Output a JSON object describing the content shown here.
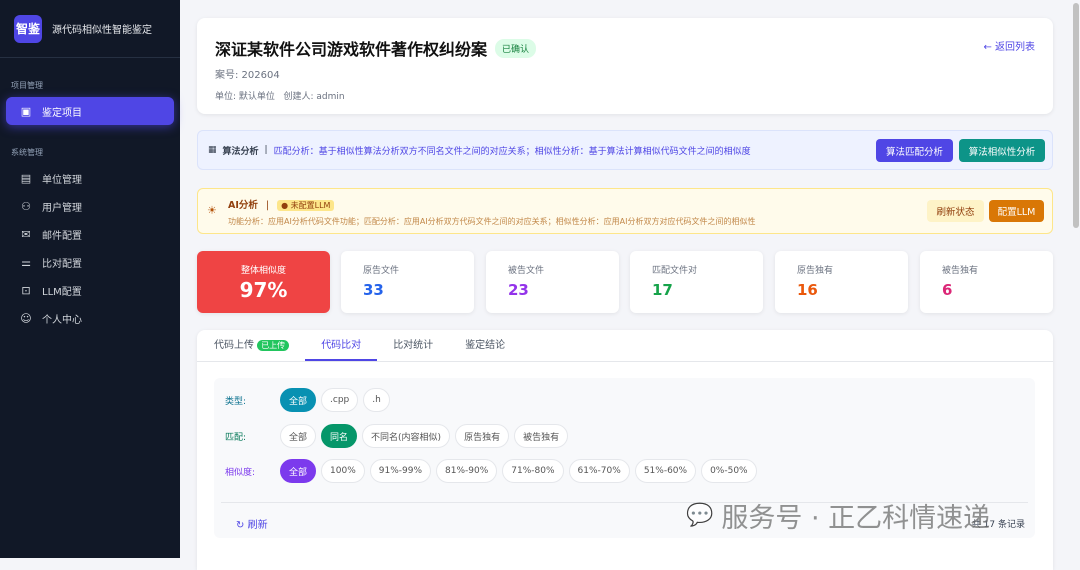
{
  "sidebar": {
    "logo_mark": "智鉴",
    "app_title": "源代码相似性智能鉴定",
    "section1": "项目管理",
    "section2": "系统管理",
    "items": [
      {
        "label": "鉴定项目"
      },
      {
        "label": "单位管理"
      },
      {
        "label": "用户管理"
      },
      {
        "label": "邮件配置"
      },
      {
        "label": "比对配置"
      },
      {
        "label": "LLM配置"
      },
      {
        "label": "个人中心"
      }
    ]
  },
  "header": {
    "title": "深证某软件公司游戏软件著作权纠纷案",
    "status": "已确认",
    "case_no": "案号: 202604",
    "unit": "单位: 默认单位",
    "creator": "创建人: admin",
    "back": "← 返回列表"
  },
  "algo": {
    "title": "算法分析",
    "sep": "|",
    "desc": "匹配分析：基于相似性算法分析双方不同名文件之间的对应关系；相似性分析：基于算法计算相似代码文件之间的相似度",
    "btn_match": "算法匹配分析",
    "btn_sim": "算法相似性分析"
  },
  "ai": {
    "title": "AI分析",
    "sep": "|",
    "badge": "● 未配置LLM",
    "desc": "功能分析：应用AI分析代码文件功能；匹配分析：应用AI分析双方代码文件之间的对应关系；相似性分析：应用AI分析双方对应代码文件之间的相似性",
    "btn_refresh": "刷新状态",
    "btn_config": "配置LLM"
  },
  "stats": [
    {
      "label": "整体相似度",
      "value": "97%"
    },
    {
      "label": "原告文件",
      "value": "33",
      "color": "#2563eb"
    },
    {
      "label": "被告文件",
      "value": "23",
      "color": "#9333ea"
    },
    {
      "label": "匹配文件对",
      "value": "17",
      "color": "#16a34a"
    },
    {
      "label": "原告独有",
      "value": "16",
      "color": "#ea580c"
    },
    {
      "label": "被告独有",
      "value": "6",
      "color": "#db2777"
    }
  ],
  "tabs": {
    "upload": "代码上传",
    "upload_badge": "已上传",
    "compare": "代码比对",
    "stats": "比对统计",
    "conclusion": "鉴定结论"
  },
  "filters": {
    "type_label": "类型:",
    "type": [
      "全部",
      ".cpp",
      ".h"
    ],
    "match_label": "匹配:",
    "match": [
      "全部",
      "同名",
      "不同名(内容相似)",
      "原告独有",
      "被告独有"
    ],
    "sim_label": "相似度:",
    "sim": [
      "全部",
      "100%",
      "91%-99%",
      "81%-90%",
      "71%-80%",
      "61%-70%",
      "51%-60%",
      "0%-50%"
    ]
  },
  "refresh": "刷新",
  "record_count": "共 17 条记录",
  "watermark": "服务号 · 正乙科情速递"
}
